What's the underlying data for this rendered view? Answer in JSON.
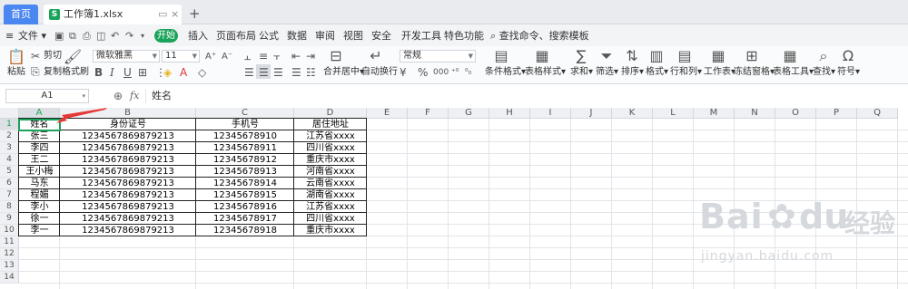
{
  "tabs": {
    "home": "首页",
    "file": "工作簿1.xlsx",
    "new_tab": "+"
  },
  "menu": {
    "file": "文件",
    "start": "开始",
    "items": [
      "插入",
      "页面布局",
      "公式",
      "数据",
      "审阅",
      "视图",
      "安全",
      "开发工具",
      "特色功能"
    ],
    "search": "查找命令、搜索模板"
  },
  "toolbar": {
    "paste": "粘贴",
    "cut": "剪切",
    "copy": "复制",
    "format_painter": "格式刷",
    "font_name": "微软雅黑",
    "font_size": "11",
    "merge_center": "合并居中",
    "wrap_text": "自动换行",
    "number_format": "常规",
    "conditional_format": "条件格式",
    "table_style": "表格样式",
    "sum": "求和",
    "filter": "筛选",
    "sort": "排序",
    "format": "格式",
    "row_col": "行和列",
    "worksheet": "工作表",
    "freeze": "冻结窗格",
    "table_tools": "表格工具",
    "find": "查找",
    "symbol": "符号"
  },
  "formula_bar": {
    "name_box": "A1",
    "fx": "fx",
    "content": "姓名"
  },
  "sheet": {
    "columns": [
      "A",
      "B",
      "C",
      "D",
      "E",
      "F",
      "G",
      "H",
      "I",
      "J",
      "K",
      "L",
      "M",
      "N",
      "O",
      "P",
      "Q"
    ],
    "rows": [
      "1",
      "2",
      "3",
      "4",
      "5",
      "6",
      "7",
      "8",
      "9",
      "10",
      "11",
      "12",
      "13",
      "14"
    ],
    "header": [
      "姓名",
      "身份证号",
      "手机号",
      "居住地址"
    ],
    "data": [
      [
        "张三",
        "123456786987921​3",
        "12345678910",
        "江苏省xxxx"
      ],
      [
        "李四",
        "123456786987921​3",
        "12345678911",
        "四川省xxxx"
      ],
      [
        "王二",
        "123456786987921​3",
        "12345678912",
        "重庆市xxxx"
      ],
      [
        "王小梅",
        "123456786987921​3",
        "12345678913",
        "河南省xxxx"
      ],
      [
        "马东",
        "123456786987921​3",
        "12345678914",
        "云南省xxxx"
      ],
      [
        "程媚",
        "123456786987921​3",
        "12345678915",
        "湖南省xxxx"
      ],
      [
        "李小",
        "123456786987921​3",
        "12345678916",
        "江苏省xxxx"
      ],
      [
        "徐一",
        "123456786987921​3",
        "12345678917",
        "四川省xxxx"
      ],
      [
        "李一",
        "123456786987921​3",
        "12345678918",
        "重庆市xxxx"
      ]
    ]
  },
  "watermark": {
    "brand": "Bai",
    "brand2": "du",
    "cn": "经验",
    "url": "jingyan.baidu.com"
  },
  "colors": {
    "accent_green": "#1aa35a",
    "home_tab_blue": "#4b87f0",
    "arrow_red": "#e53935"
  }
}
